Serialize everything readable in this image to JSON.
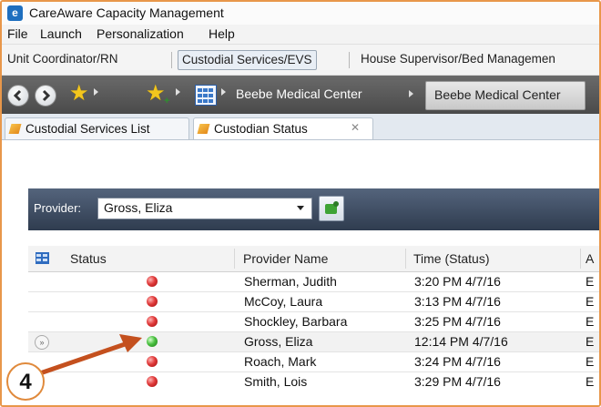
{
  "window": {
    "title": "CareAware Capacity Management",
    "app_icon": "e"
  },
  "menu": [
    "File",
    "Launch",
    "Personalization",
    "Help"
  ],
  "personalization_tabs": [
    {
      "label": "Unit Coordinator/RN"
    },
    {
      "label": "Custodial Services/EVS",
      "active": true
    },
    {
      "label": "House Supervisor/Bed Managemen"
    }
  ],
  "navbar": {
    "breadcrumb_1": "Beebe Medical Center",
    "breadcrumb_2": "Beebe Medical Center"
  },
  "tabs": [
    {
      "label": "Custodial Services List",
      "active": false
    },
    {
      "label": "Custodian Status",
      "active": true
    }
  ],
  "provider": {
    "label": "Provider:",
    "selected": "Gross, Eliza"
  },
  "table": {
    "headers": [
      "Status",
      "Provider Name",
      "Time (Status)",
      "A"
    ],
    "rows": [
      {
        "status": "red",
        "name": "Sherman, Judith",
        "time": "3:20 PM  4/7/16",
        "col4": "E"
      },
      {
        "status": "red",
        "name": "McCoy, Laura",
        "time": "3:13 PM  4/7/16",
        "col4": "E"
      },
      {
        "status": "red",
        "name": "Shockley, Barbara",
        "time": "3:25 PM  4/7/16",
        "col4": "E"
      },
      {
        "status": "green",
        "name": "Gross, Eliza",
        "time": "12:14 PM  4/7/16",
        "col4": "E",
        "selected": true
      },
      {
        "status": "red",
        "name": "Roach, Mark",
        "time": "3:24 PM  4/7/16",
        "col4": "E"
      },
      {
        "status": "red",
        "name": "Smith, Lois",
        "time": "3:29 PM  4/7/16",
        "col4": "E"
      }
    ]
  },
  "annotation": {
    "number": "4"
  },
  "colors": {
    "accent_border": "#e8974a",
    "navbar": "#5a5a5a",
    "provider_bar": "#3e4c61",
    "status_red": "#e03a3a",
    "status_green": "#49c040"
  }
}
